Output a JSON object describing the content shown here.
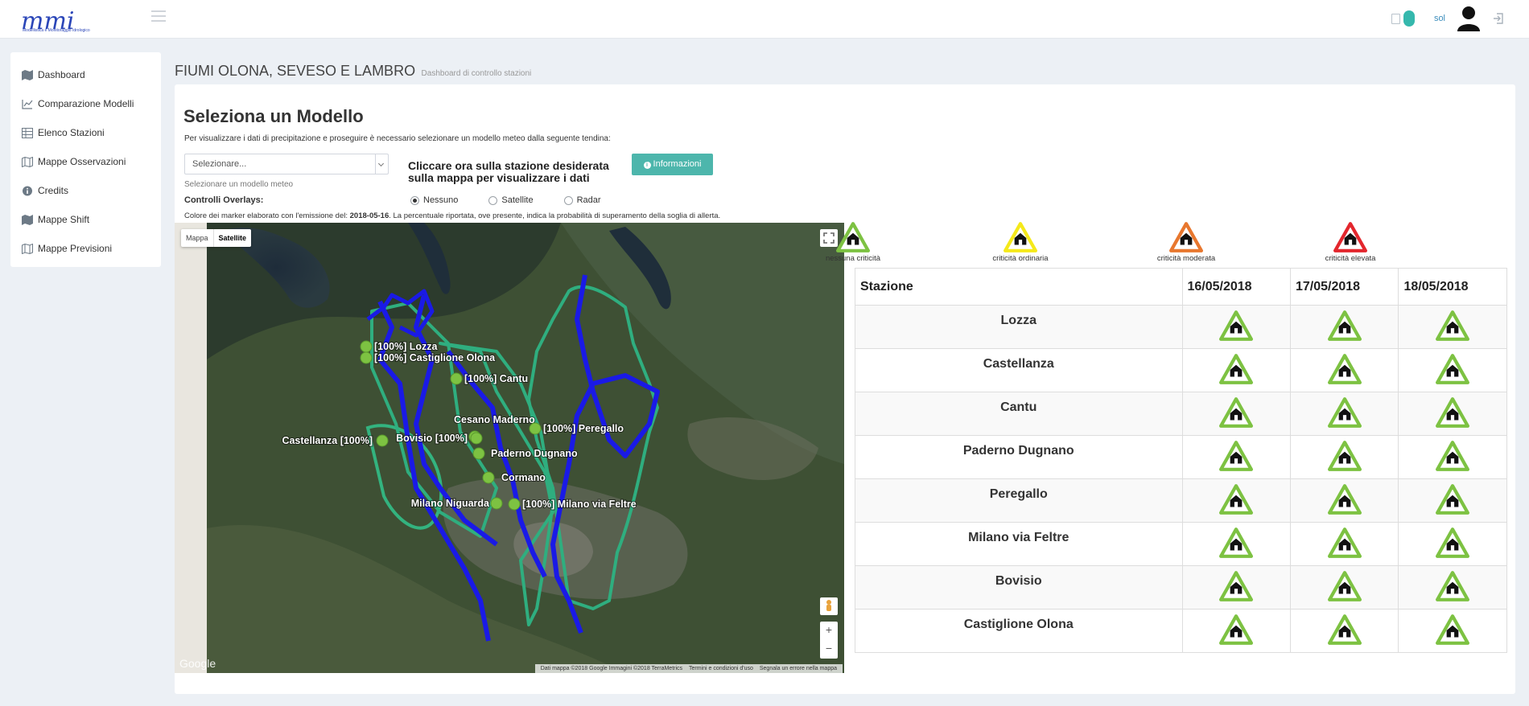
{
  "header": {
    "logo_text": "mmi",
    "logo_subtitle": "Modellistica e Monitoraggio Idrologico",
    "user_name": "sol"
  },
  "sidebar": {
    "items": [
      {
        "label": "Dashboard",
        "icon": "map-icon"
      },
      {
        "label": "Comparazione Modelli",
        "icon": "line-chart-icon"
      },
      {
        "label": "Elenco Stazioni",
        "icon": "table-icon"
      },
      {
        "label": "Mappe Osservazioni",
        "icon": "map-outline-icon"
      },
      {
        "label": "Credits",
        "icon": "info-icon"
      },
      {
        "label": "Mappe Shift",
        "icon": "map-icon"
      },
      {
        "label": "Mappe Previsioni",
        "icon": "map-outline-icon"
      }
    ]
  },
  "page": {
    "title": "FIUMI OLONA, SEVESO E LAMBRO",
    "subtitle": "Dashboard di controllo stazioni"
  },
  "selector": {
    "title": "Seleziona un Modello",
    "description": "Per visualizzare i dati di precipitazione e proseguire è necessario selezionare un modello meteo dalla seguente tendina:",
    "value": "Selezionare...",
    "help": "Selezionare un modello meteo",
    "instruction": "Cliccare ora sulla stazione desiderata sulla mappa per visualizzare i dati",
    "info_button": "Informazioni"
  },
  "overlays": {
    "label": "Controlli Overlays:",
    "options": [
      {
        "label": "Nessuno",
        "selected": true
      },
      {
        "label": "Satellite",
        "selected": false
      },
      {
        "label": "Radar",
        "selected": false
      }
    ]
  },
  "note": {
    "prefix": "Colore dei marker elaborato con l'emissione del: ",
    "date": "2018-05-16",
    "suffix": ". La percentuale riportata, ove presente, indica la probabilità di superamento della soglia di allerta."
  },
  "map": {
    "type_map": "Mappa",
    "type_satellite": "Satellite",
    "active_type": "Satellite",
    "google": "Google",
    "footer": [
      "Dati mappa ©2018 Google Immagini ©2018 TerraMetrics",
      "Termini e condizioni d'uso",
      "Segnala un errore nella mappa"
    ],
    "marker_color": "#7dc242",
    "labels": [
      "[100%]  Lozza",
      "[100%]  Castiglione Olona",
      "[100%]  Cantu",
      "Cesano Maderno",
      "[100%]  Peregallo",
      "Castellanza  [100%]",
      "Bovisio  [100%]",
      "Paderno Dugnano",
      "Cormano",
      "Milano Niguarda",
      "[100%]  Milano via Feltre"
    ]
  },
  "legend": [
    {
      "label": "nessuna criticità",
      "color": "#7dc242"
    },
    {
      "label": "criticità ordinaria",
      "color": "#f5e91a"
    },
    {
      "label": "criticità moderata",
      "color": "#e8772e"
    },
    {
      "label": "criticità elevata",
      "color": "#e3262d"
    }
  ],
  "table": {
    "headers": [
      "Stazione",
      "16/05/2018",
      "17/05/2018",
      "18/05/2018"
    ],
    "rows": [
      {
        "station": "Lozza",
        "levels": [
          "nessuna",
          "nessuna",
          "nessuna"
        ]
      },
      {
        "station": "Castellanza",
        "levels": [
          "nessuna",
          "nessuna",
          "nessuna"
        ]
      },
      {
        "station": "Cantu",
        "levels": [
          "nessuna",
          "nessuna",
          "nessuna"
        ]
      },
      {
        "station": "Paderno Dugnano",
        "levels": [
          "nessuna",
          "nessuna",
          "nessuna"
        ]
      },
      {
        "station": "Peregallo",
        "levels": [
          "nessuna",
          "nessuna",
          "nessuna"
        ]
      },
      {
        "station": "Milano via Feltre",
        "levels": [
          "nessuna",
          "nessuna",
          "nessuna"
        ]
      },
      {
        "station": "Bovisio",
        "levels": [
          "nessuna",
          "nessuna",
          "nessuna"
        ]
      },
      {
        "station": "Castiglione Olona",
        "levels": [
          "nessuna",
          "nessuna",
          "nessuna"
        ]
      }
    ]
  }
}
